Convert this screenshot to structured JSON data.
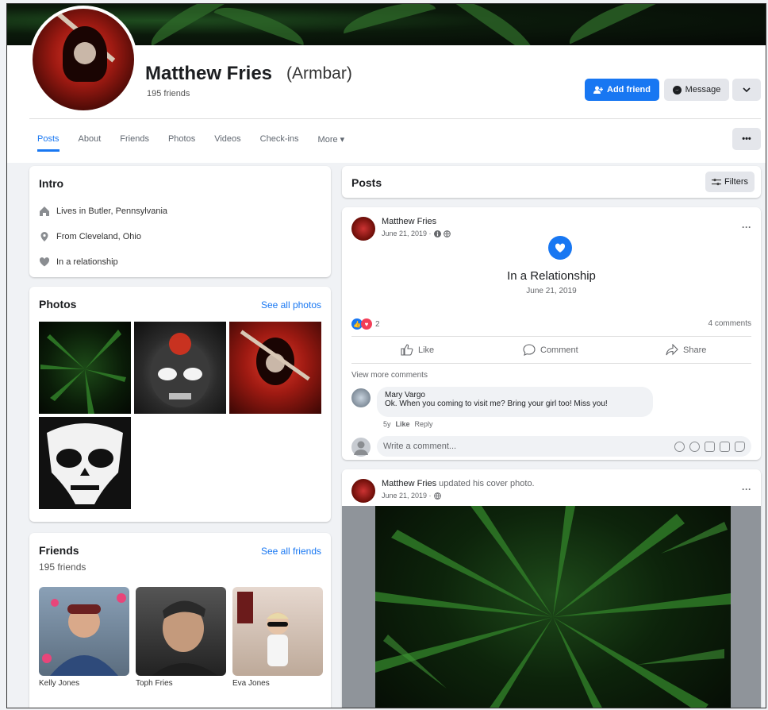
{
  "profile": {
    "name": "Matthew Fries",
    "alternate_name": "(Armbar)",
    "friends_count": "195 friends"
  },
  "actions": {
    "add_friend": "Add friend",
    "message": "Message"
  },
  "tabs": [
    {
      "label": "Posts",
      "active": true
    },
    {
      "label": "About"
    },
    {
      "label": "Friends"
    },
    {
      "label": "Photos"
    },
    {
      "label": "Videos"
    },
    {
      "label": "Check-ins"
    },
    {
      "label": "More ▾"
    }
  ],
  "tabs_more_button": "•••",
  "intro": {
    "title": "Intro",
    "items": [
      {
        "icon": "home-icon",
        "text": "Lives in Butler, Pennsylvania"
      },
      {
        "icon": "location-pin-icon",
        "text": "From Cleveland, Ohio"
      },
      {
        "icon": "heart-icon",
        "text": "In a relationship"
      }
    ]
  },
  "photos": {
    "title": "Photos",
    "see_all": "See all photos"
  },
  "friends": {
    "title": "Friends",
    "count": "195 friends",
    "see_all": "See all friends",
    "list": [
      {
        "name": "Kelly Jones"
      },
      {
        "name": "Toph Fries"
      },
      {
        "name": "Eva Jones"
      }
    ]
  },
  "posts_header": {
    "title": "Posts",
    "filters": "Filters"
  },
  "post1": {
    "author": "Matthew Fries",
    "date": "June 21, 2019 ·",
    "event_title": "In a Relationship",
    "event_date": "June 21, 2019",
    "reaction_count": "2",
    "comments_count": "4 comments",
    "like": "Like",
    "comment": "Comment",
    "share": "Share",
    "view_more": "View more comments",
    "comment_author": "Mary Vargo",
    "comment_text": "Ok. When you coming to visit me? Bring your girl too! Miss you!",
    "comment_age": "5y",
    "comment_like": "Like",
    "comment_reply": "Reply",
    "write_placeholder": "Write a comment..."
  },
  "post2": {
    "author": "Matthew Fries",
    "action": "updated his cover photo.",
    "date": "June 21, 2019 ·"
  },
  "colors": {
    "accent": "#1877f2",
    "background": "#f0f2f5"
  }
}
